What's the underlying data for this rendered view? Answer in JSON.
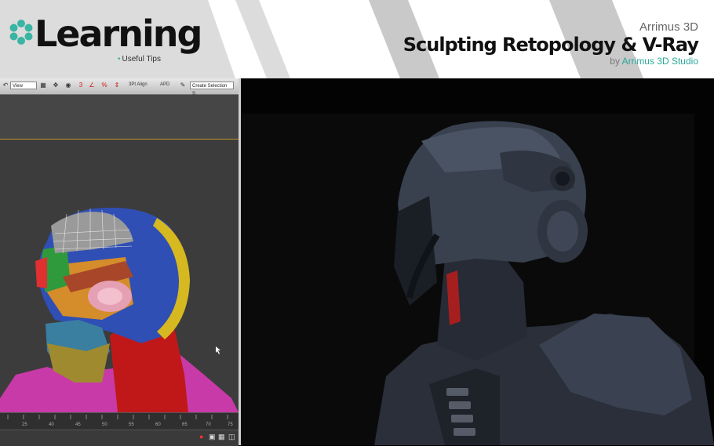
{
  "header": {
    "logo_word": "Learning",
    "logo_tagline": "Useful Tips",
    "brand": "Arrimus 3D",
    "course_title": "Sculpting Retopology & V-Ray",
    "byline_prefix": "by",
    "byline_studio": "Arrimus 3D Studio"
  },
  "toolbar": {
    "view_dropdown": "View",
    "align_label": "3Pt Align",
    "apd_label": "APD",
    "selection_dropdown": "Create Selection S"
  },
  "timeline": {
    "ticks": [
      "25",
      "40",
      "45",
      "50",
      "55",
      "60",
      "65",
      "70",
      "75"
    ]
  },
  "colors": {
    "accent_teal": "#3ab5a3",
    "header_bg": "#dcdcdc",
    "viewport_bg": "#3c3c3c",
    "ribbon_line": "#c4962f"
  }
}
